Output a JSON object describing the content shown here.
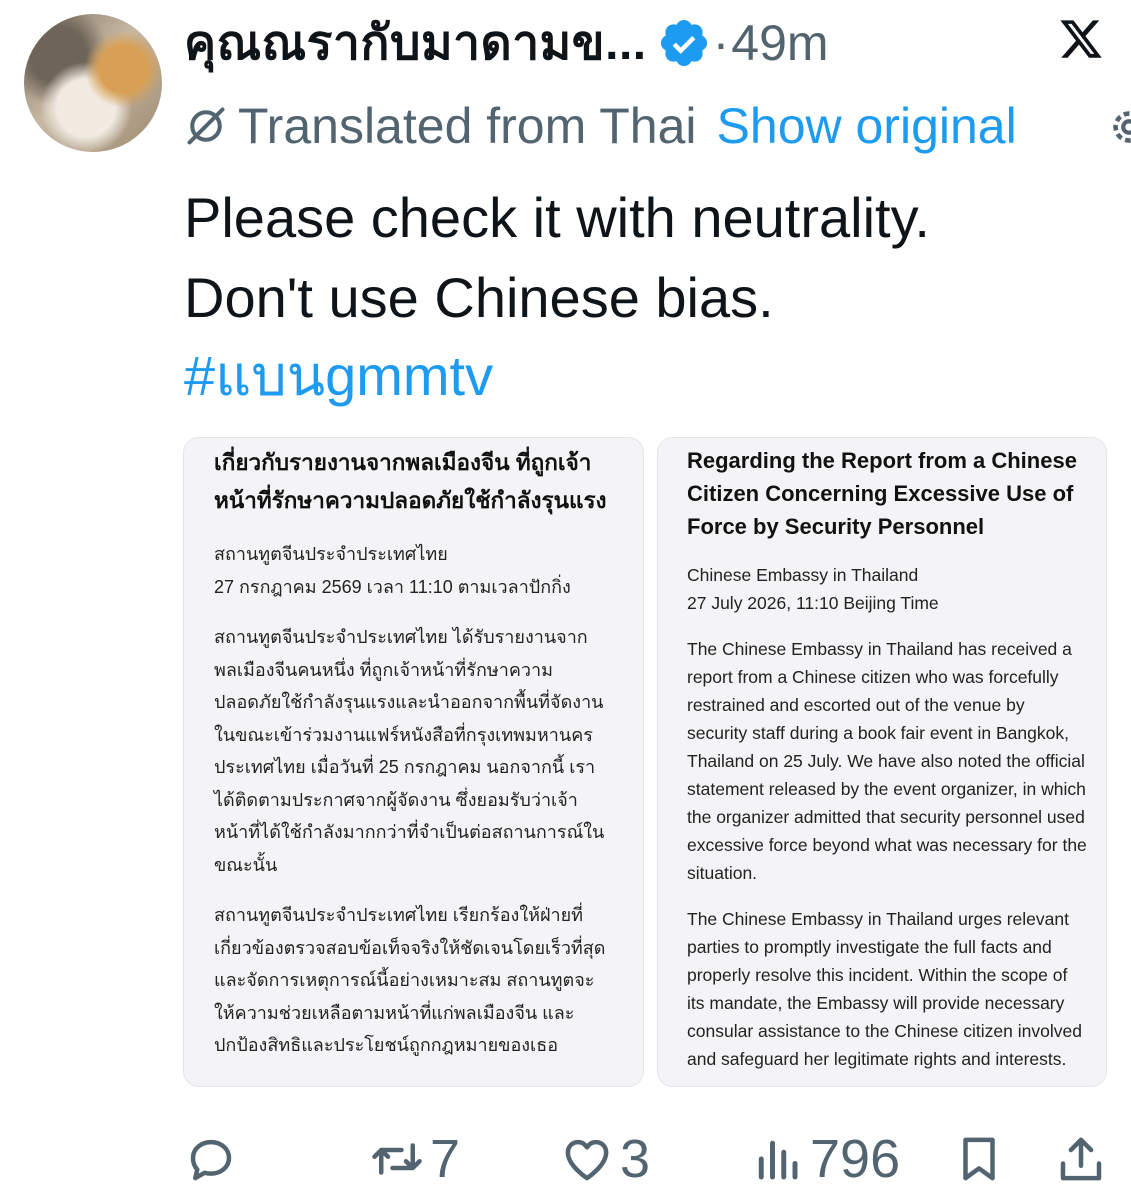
{
  "header": {
    "display_name": "คุณณรากับมาดามข...",
    "separator": "·",
    "time": "49m"
  },
  "translation": {
    "label": "Translated from Thai",
    "show_original": "Show original"
  },
  "tweet": {
    "lines": [
      "Please check it with neutrality.",
      "Don't use Chinese bias."
    ],
    "hashtag": "#แบนgmmtv"
  },
  "images": {
    "thai": {
      "title": "เกี่ยวกับรายงานจากพลเมืองจีน ที่ถูกเจ้าหน้าที่รักษาความปลอดภัยใช้กำลังรุนแรง",
      "meta_lines": [
        "สถานทูตจีนประจำประเทศไทย",
        "27 กรกฎาคม 2569 เวลา 11:10 ตามเวลาปักกิ่ง"
      ],
      "paragraphs": [
        "สถานทูตจีนประจำประเทศไทย ได้รับรายงานจากพลเมืองจีนคนหนึ่ง ที่ถูกเจ้าหน้าที่รักษาความปลอดภัยใช้กำลังรุนแรงและนำออกจากพื้นที่จัดงาน ในขณะเข้าร่วมงานแฟร์หนังสือที่กรุงเทพมหานคร ประเทศไทย เมื่อวันที่ 25 กรกฎาคม นอกจากนี้ เราได้ติดตามประกาศจากผู้จัดงาน ซึ่งยอมรับว่าเจ้าหน้าที่ได้ใช้กำลังมากกว่าที่จำเป็นต่อสถานการณ์ในขณะนั้น",
        "สถานทูตจีนประจำประเทศไทย เรียกร้องให้ฝ่ายที่เกี่ยวข้องตรวจสอบข้อเท็จจริงให้ชัดเจนโดยเร็วที่สุด และจัดการเหตุการณ์นี้อย่างเหมาะสม สถานทูตจะให้ความช่วยเหลือตามหน้าที่แก่พลเมืองจีน และปกป้องสิทธิและประโยชน์ถูกกฎหมายของเธอ"
      ]
    },
    "english": {
      "title": "Regarding the Report from a Chinese Citizen Concerning Excessive Use of Force by Security Personnel",
      "meta_lines": [
        "Chinese Embassy in Thailand",
        "27 July 2026, 11:10 Beijing Time"
      ],
      "paragraphs": [
        "The Chinese Embassy in Thailand has received a report from a Chinese citizen who was forcefully restrained and escorted out of the venue by security staff during a book fair event in Bangkok, Thailand on 25 July. We have also noted the official statement released by the event organizer, in which the organizer admitted that security personnel used excessive force beyond what was necessary for the situation.",
        "The Chinese Embassy in Thailand urges relevant parties to promptly investigate the full facts and properly resolve this incident. Within the scope of its mandate, the Embassy will provide necessary consular assistance to the Chinese citizen involved and safeguard her legitimate rights and interests."
      ]
    }
  },
  "actions": {
    "reply": {
      "icon": "reply-icon",
      "count": ""
    },
    "retweet": {
      "icon": "retweet-icon",
      "count": "7"
    },
    "like": {
      "icon": "heart-icon",
      "count": "3"
    },
    "views": {
      "icon": "views-icon",
      "count": "796"
    },
    "bookmark": {
      "icon": "bookmark-icon"
    },
    "share": {
      "icon": "share-icon"
    }
  },
  "colors": {
    "text_primary": "#0f1419",
    "text_secondary": "#536471",
    "link": "#1d9bf0",
    "card_bg": "#f4f4f6"
  }
}
